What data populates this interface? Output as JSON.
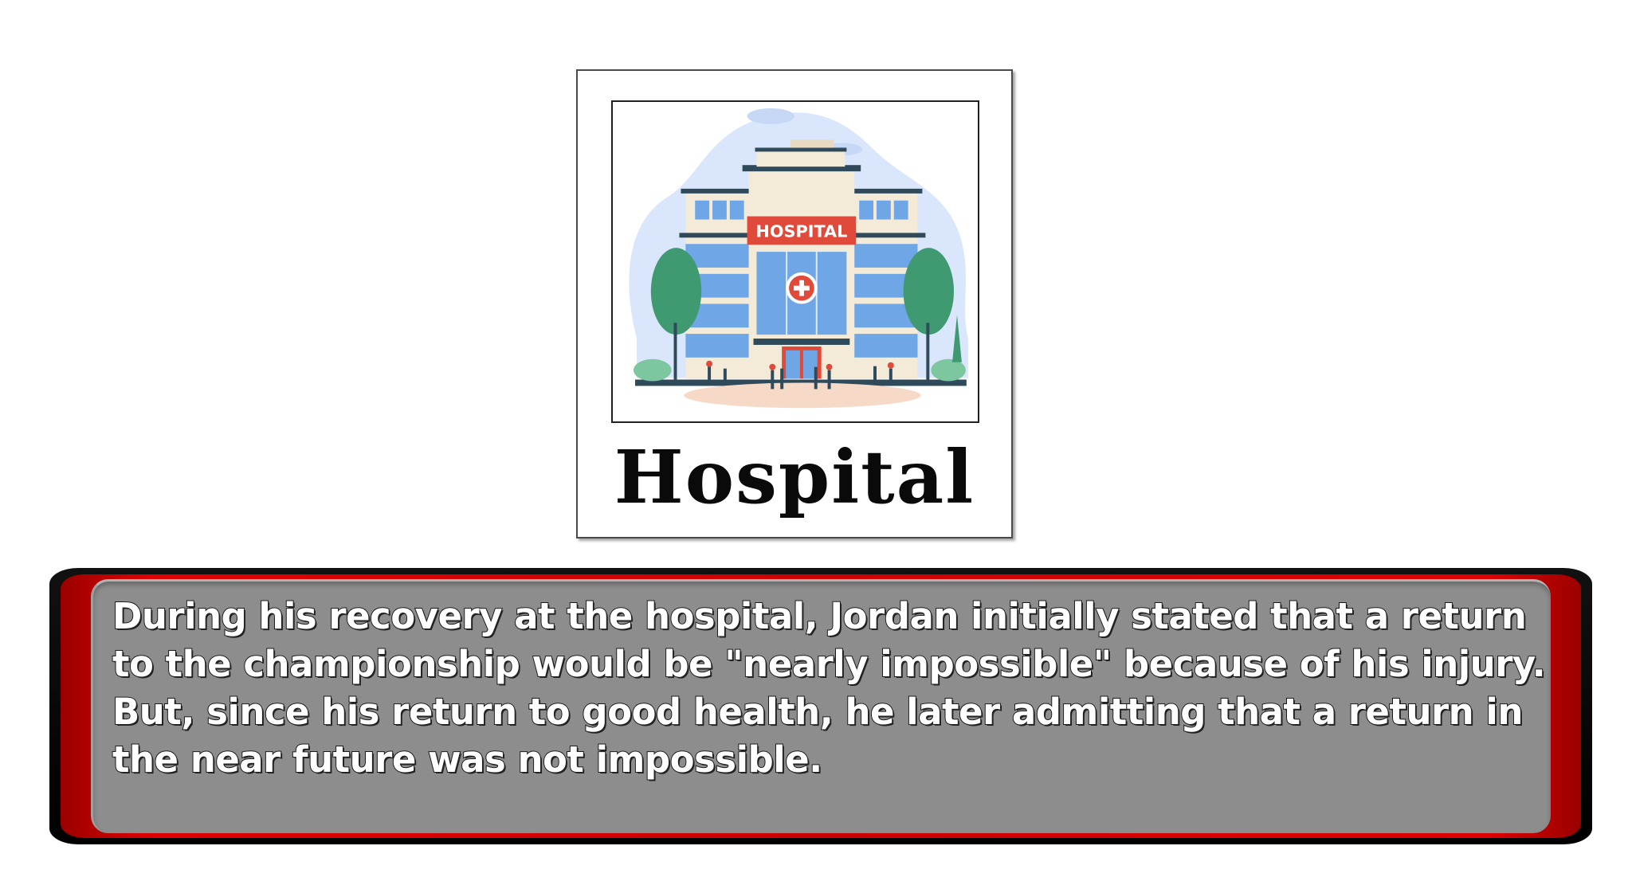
{
  "polaroid": {
    "caption": "Hospital",
    "sign_text": "HOSPITAL"
  },
  "banner": {
    "text": "During his recovery at the hospital, Jordan initially stated that a return to the championship would be \"nearly impossible\" because of his injury. But, since his return to good health, he later admitting that a return in the near future was not impossible."
  },
  "colors": {
    "banner_red": "#cc0000",
    "banner_gray": "#8d8d8d",
    "sign_red": "#e04a3a",
    "building_blue": "#6fa6e6",
    "tree_green": "#3f9a72"
  }
}
